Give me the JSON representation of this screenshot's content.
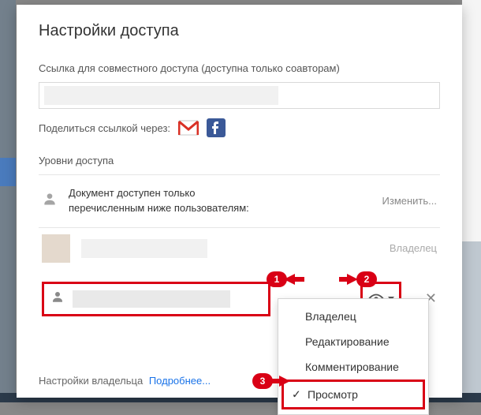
{
  "title": "Настройки доступа",
  "link_section_label": "Ссылка для совместного доступа (доступна только соавторам)",
  "share_via_label": "Поделиться ссылкой через:",
  "levels_label": "Уровни доступа",
  "restricted_text_l1": "Документ доступен только",
  "restricted_text_l2": "перечисленным ниже пользователям:",
  "change_link": "Изменить...",
  "owner_role": "Владелец",
  "dropdown": {
    "owner": "Владелец",
    "edit": "Редактирование",
    "comment": "Комментирование",
    "view": "Просмотр"
  },
  "footer_text": "Настройки владельца",
  "footer_link": "Подробнее...",
  "callouts": {
    "c1": "1",
    "c2": "2",
    "c3": "3"
  },
  "colors": {
    "accent": "#d90015",
    "facebook": "#3b5998"
  }
}
